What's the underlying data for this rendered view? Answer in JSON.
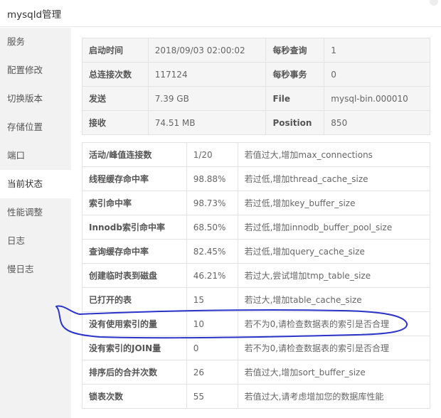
{
  "window": {
    "title": "mysqld管理"
  },
  "sidebar": {
    "items": [
      {
        "label": "服务"
      },
      {
        "label": "配置修改"
      },
      {
        "label": "切换版本"
      },
      {
        "label": "存储位置"
      },
      {
        "label": "端口"
      },
      {
        "label": "当前状态",
        "active": true
      },
      {
        "label": "性能调整"
      },
      {
        "label": "日志"
      },
      {
        "label": "慢日志"
      }
    ]
  },
  "summary": {
    "rows": [
      {
        "k1": "启动时间",
        "v1": "2018/09/03 02:00:02",
        "k2": "每秒查询",
        "v2": "1"
      },
      {
        "k1": "总连接次数",
        "v1": "117124",
        "k2": "每秒事务",
        "v2": "0"
      },
      {
        "k1": "发送",
        "v1": "7.39 GB",
        "k2": "File",
        "v2": "mysql-bin.000010"
      },
      {
        "k1": "接收",
        "v1": "74.51 MB",
        "k2": "Position",
        "v2": "850"
      }
    ]
  },
  "metrics": {
    "rows": [
      {
        "name": "活动/峰值连接数",
        "value": "1/20",
        "tip": "若值过大,增加max_connections"
      },
      {
        "name": "线程缓存命中率",
        "value": "98.88%",
        "tip": "若过低,增加thread_cache_size"
      },
      {
        "name": "索引命中率",
        "value": "98.73%",
        "tip": "若过低,增加key_buffer_size"
      },
      {
        "name": "Innodb索引命中率",
        "value": "68.50%",
        "tip": "若过低,增加innodb_buffer_pool_size"
      },
      {
        "name": "查询缓存命中率",
        "value": "82.45%",
        "tip": "若过低,增加query_cache_size"
      },
      {
        "name": "创建临时表到磁盘",
        "value": "46.21%",
        "tip": "若过大,尝试增加tmp_table_size"
      },
      {
        "name": "已打开的表",
        "value": "15",
        "tip": "若过大,增加table_cache_size"
      },
      {
        "name": "没有使用索引的量",
        "value": "10",
        "tip": "若不为0,请检查数据表的索引是否合理"
      },
      {
        "name": "没有索引的JOIN量",
        "value": "0",
        "tip": "若不为0,请检查数据表的索引是否合理"
      },
      {
        "name": "排序后的合并次数",
        "value": "26",
        "tip": "若值过大,增加sort_buffer_size"
      },
      {
        "name": "锁表次数",
        "value": "55",
        "tip": "若值过大,请考虑增加您的数据库性能"
      }
    ]
  },
  "annotation": {
    "color": "#2b34c9"
  }
}
